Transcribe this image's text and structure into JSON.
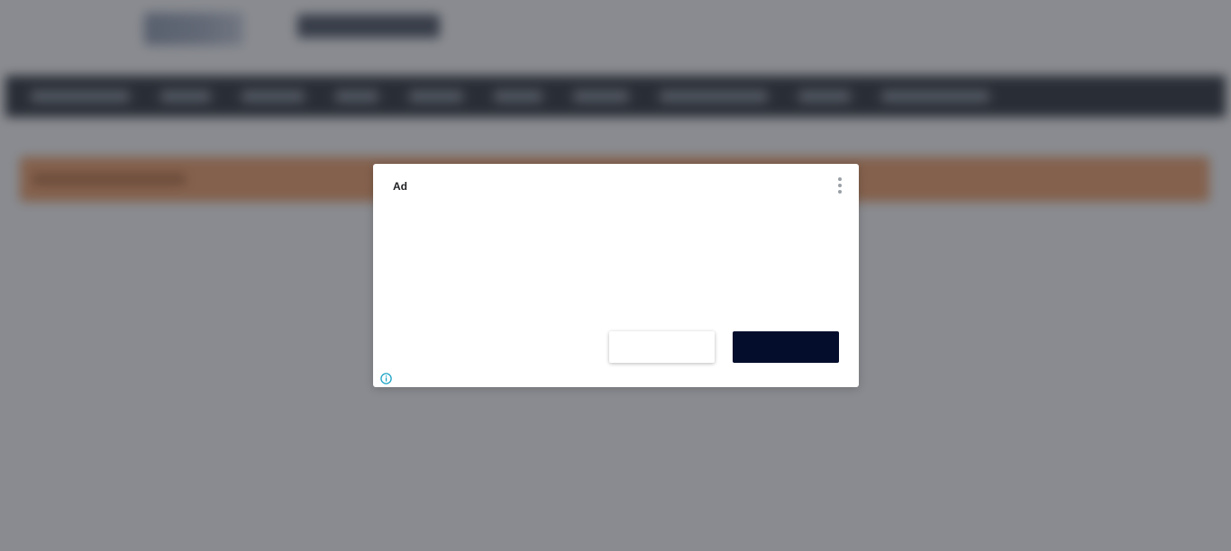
{
  "dialog": {
    "label": "Ad",
    "menu_icon": "more-vert-icon",
    "info_icon": "info-icon",
    "secondary_button_label": "",
    "primary_button_label": ""
  },
  "colors": {
    "overlay": "#282c34",
    "primary_button": "#050d2c",
    "info_icon": "#1aa3c4",
    "banner": "#f3a26a",
    "nav_bar": "#2c3138"
  }
}
